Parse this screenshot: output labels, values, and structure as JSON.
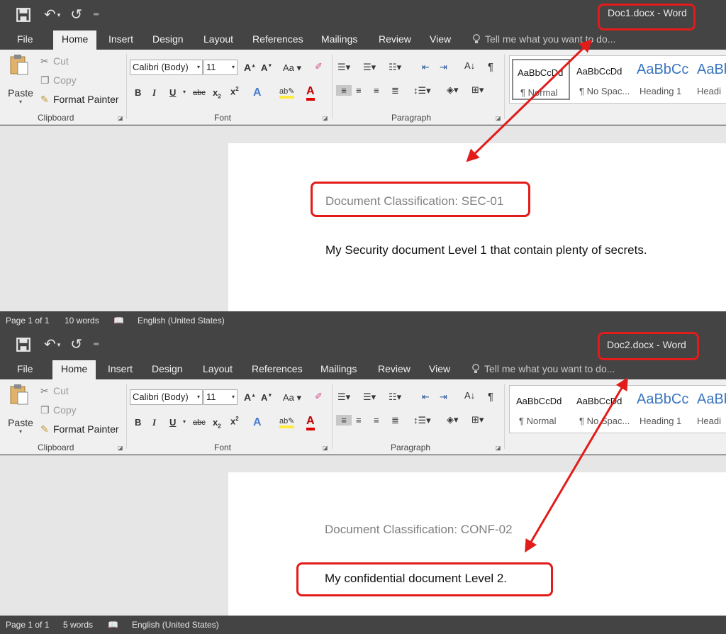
{
  "windows": [
    {
      "title": "Doc1.docx - Word",
      "tabs": [
        "File",
        "Home",
        "Insert",
        "Design",
        "Layout",
        "References",
        "Mailings",
        "Review",
        "View"
      ],
      "tell_me": "Tell me what you want to do...",
      "clipboard": {
        "paste": "Paste",
        "cut": "Cut",
        "copy": "Copy",
        "format_painter": "Format Painter",
        "group": "Clipboard"
      },
      "font": {
        "family": "Calibri (Body)",
        "size": "11",
        "group": "Font"
      },
      "paragraph": {
        "group": "Paragraph"
      },
      "styles": [
        {
          "sample": "AaBbCcDd",
          "name": "¶ Normal"
        },
        {
          "sample": "AaBbCcDd",
          "name": "¶ No Spac..."
        },
        {
          "sample": "AaBbCc",
          "name": "Heading 1"
        },
        {
          "sample": "AaBb",
          "name": "Headi"
        }
      ],
      "doc": {
        "classification": "Document Classification: SEC-01",
        "body": "My Security document Level 1 that contain plenty of secrets."
      },
      "status": {
        "page": "Page 1 of 1",
        "words": "10 words",
        "language": "English (United States)"
      }
    },
    {
      "title": "Doc2.docx - Word",
      "tabs": [
        "File",
        "Home",
        "Insert",
        "Design",
        "Layout",
        "References",
        "Mailings",
        "Review",
        "View"
      ],
      "tell_me": "Tell me what you want to do...",
      "clipboard": {
        "paste": "Paste",
        "cut": "Cut",
        "copy": "Copy",
        "format_painter": "Format Painter",
        "group": "Clipboard"
      },
      "font": {
        "family": "Calibri (Body)",
        "size": "11",
        "group": "Font"
      },
      "paragraph": {
        "group": "Paragraph"
      },
      "styles": [
        {
          "sample": "AaBbCcDd",
          "name": "¶ Normal"
        },
        {
          "sample": "AaBbCcDd",
          "name": "¶ No Spac..."
        },
        {
          "sample": "AaBbCc",
          "name": "Heading 1"
        },
        {
          "sample": "AaBb",
          "name": "Headi"
        }
      ],
      "doc": {
        "classification": "Document Classification: CONF-02",
        "body": "My confidential document Level 2."
      },
      "status": {
        "page": "Page 1 of 1",
        "words": "5 words",
        "language": "English (United States)"
      }
    }
  ],
  "colors": {
    "chrome": "#444444",
    "ribbon": "#f0f0f0",
    "canvas": "#e6e6e6",
    "highlight": "#e21b1b",
    "heading_blue": "#3a75c0"
  }
}
